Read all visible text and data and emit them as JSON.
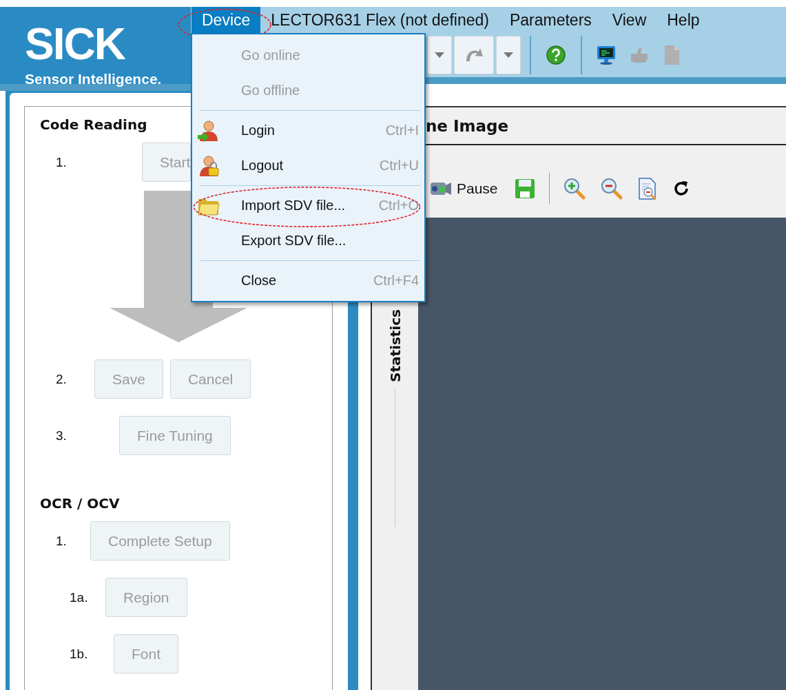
{
  "logo": {
    "brand": "SICK",
    "tagline": "Sensor Intelligence."
  },
  "menu_bar": [
    {
      "label": "Device",
      "selected": true,
      "highlighted": true
    },
    {
      "label": "LECTOR631 Flex (not defined)",
      "selected": false,
      "highlighted": false
    },
    {
      "label": "Parameters",
      "selected": false,
      "highlighted": false
    },
    {
      "label": "View",
      "selected": false,
      "highlighted": false
    },
    {
      "label": "Help",
      "selected": false,
      "highlighted": false
    }
  ],
  "toolbar": [
    {
      "kind": "dropdown",
      "disabled": false
    },
    {
      "kind": "redo",
      "disabled": true
    },
    {
      "kind": "dropdown",
      "disabled": false
    },
    {
      "kind": "separator"
    },
    {
      "kind": "help",
      "disabled": false
    },
    {
      "kind": "separator"
    },
    {
      "kind": "monitor",
      "disabled": false
    },
    {
      "kind": "hand",
      "disabled": true
    },
    {
      "kind": "document",
      "disabled": true
    }
  ],
  "device_menu": [
    {
      "kind": "item",
      "label": "Go online",
      "disabled": true,
      "highlighted": false
    },
    {
      "kind": "item",
      "label": "Go offline",
      "disabled": true,
      "highlighted": false
    },
    {
      "kind": "separator"
    },
    {
      "kind": "item",
      "label": "Login",
      "shortcut": "Ctrl+I",
      "disabled": false,
      "highlighted": false
    },
    {
      "kind": "item",
      "label": "Logout",
      "shortcut": "Ctrl+U",
      "disabled": false,
      "highlighted": false
    },
    {
      "kind": "separator"
    },
    {
      "kind": "item",
      "label": "Import SDV file...",
      "shortcut": "Ctrl+O",
      "disabled": false,
      "highlighted": true
    },
    {
      "kind": "item",
      "label": "Export SDV file...",
      "disabled": false,
      "highlighted": false
    },
    {
      "kind": "separator"
    },
    {
      "kind": "item",
      "label": "Close",
      "shortcut": "Ctrl+F4",
      "disabled": false,
      "highlighted": false
    }
  ],
  "wizard": [
    {
      "title": "Code Reading",
      "steps": [
        {
          "kind": "step",
          "number": "1.",
          "buttons": [
            {
              "label": "Start",
              "disabled": true
            }
          ]
        },
        {
          "kind": "arrow"
        },
        {
          "kind": "step",
          "number": "2.",
          "buttons": [
            {
              "label": "Save",
              "disabled": true
            },
            {
              "label": "Cancel",
              "disabled": true
            }
          ]
        },
        {
          "kind": "step",
          "number": "3.",
          "buttons": [
            {
              "label": "Fine Tuning",
              "disabled": true
            }
          ]
        }
      ]
    },
    {
      "title": "OCR / OCV",
      "steps": [
        {
          "kind": "step",
          "number": "1.",
          "buttons": [
            {
              "label": "Complete Setup",
              "disabled": true
            }
          ]
        },
        {
          "kind": "step",
          "number": "1a.",
          "buttons": [
            {
              "label": "Region",
              "disabled": true
            }
          ]
        },
        {
          "kind": "step",
          "number": "1b.",
          "buttons": [
            {
              "label": "Font",
              "disabled": true
            }
          ]
        }
      ]
    }
  ],
  "image_panel": {
    "title": "ne Image",
    "side_tab": "Statistics",
    "toolbar": [
      {
        "kind": "video",
        "label": "Pause"
      },
      {
        "kind": "save"
      },
      {
        "kind": "separator"
      },
      {
        "kind": "zoom-in"
      },
      {
        "kind": "zoom-out"
      },
      {
        "kind": "fit"
      },
      {
        "kind": "refresh"
      }
    ]
  }
}
